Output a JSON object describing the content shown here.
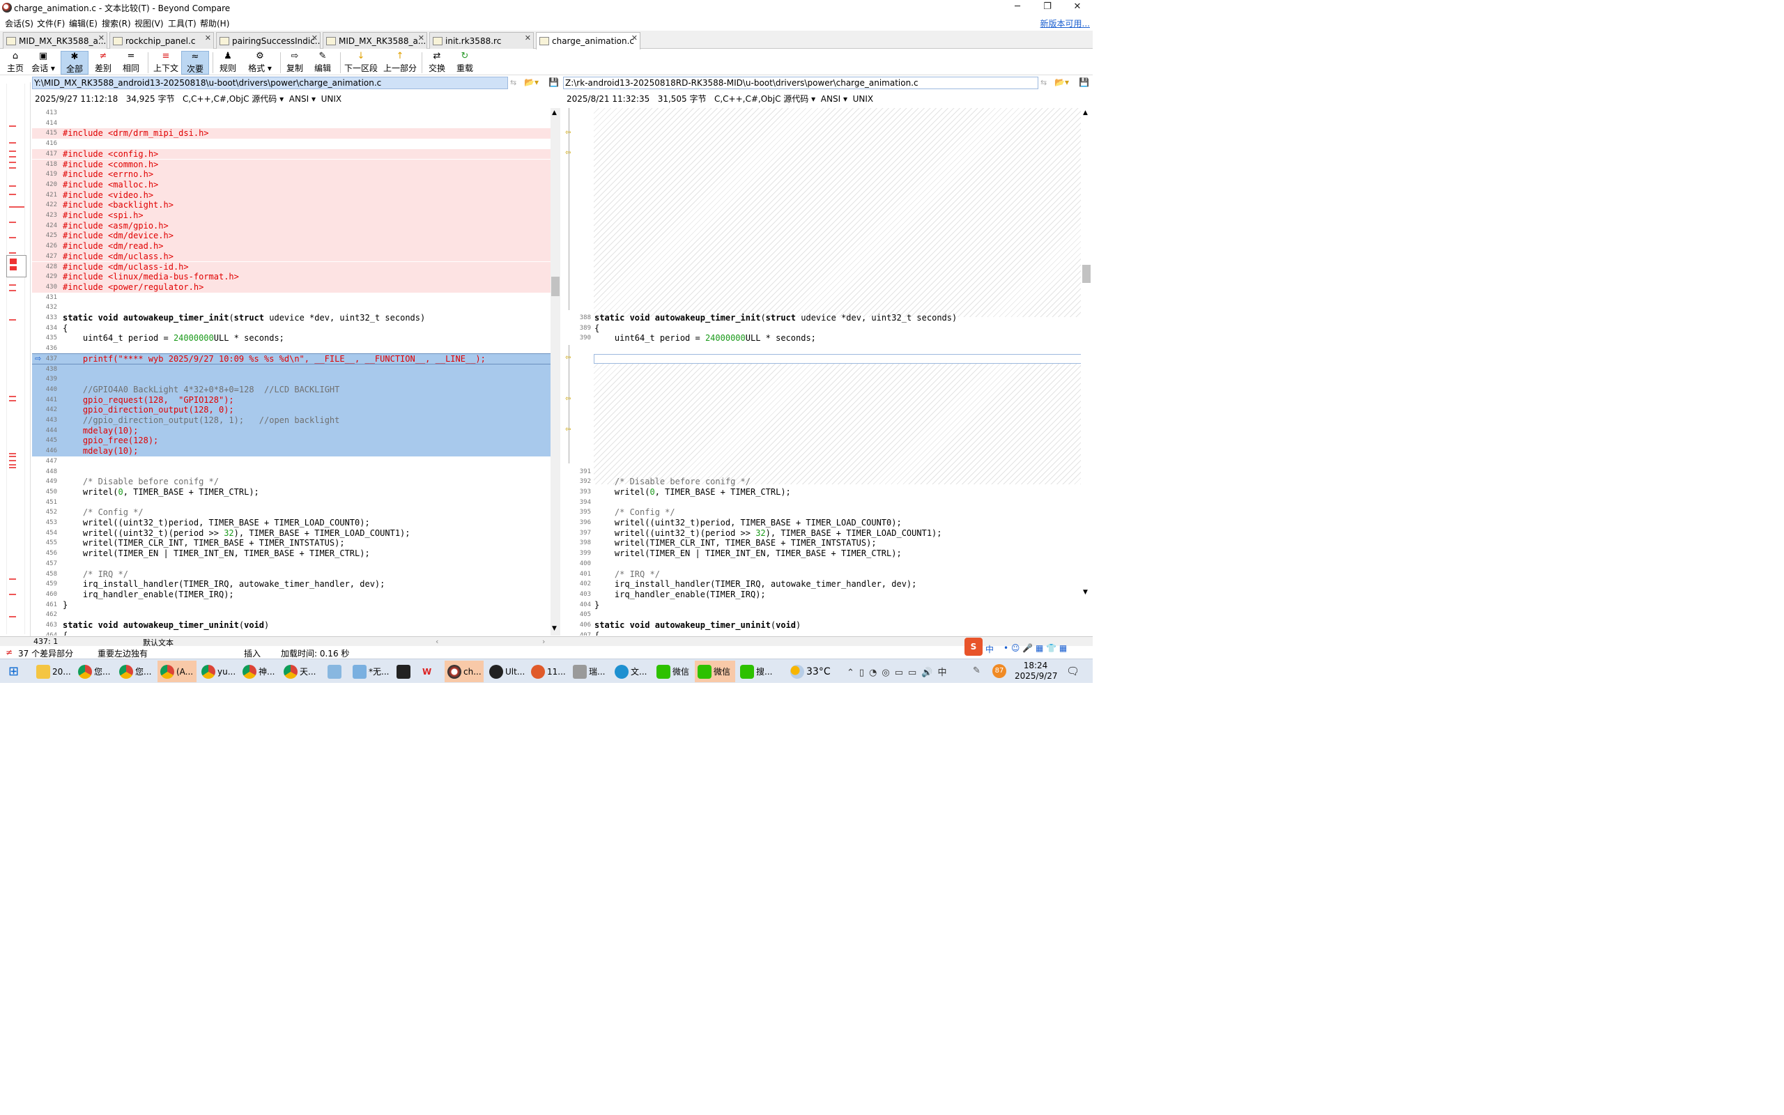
{
  "window": {
    "title": "charge_animation.c - 文本比较(T) - Beyond Compare",
    "min": "─",
    "max": "❐",
    "close": "✕"
  },
  "menu": {
    "items": [
      "会话(S)",
      "文件(F)",
      "编辑(E)",
      "搜索(R)",
      "视图(V)",
      "工具(T)",
      "帮助(H)"
    ],
    "notice": "新版本可用..."
  },
  "tabs": [
    "MID_MX_RK3588_a...",
    "rockchip_panel.c",
    "pairingSuccessIndic...",
    "MID_MX_RK3588_a...",
    "init.rk3588.rc",
    "charge_animation.c"
  ],
  "toolbar": {
    "home": "主页",
    "session": "会话",
    "all": "全部",
    "diff": "差别",
    "same": "相同",
    "context": "上下文",
    "minor": "次要",
    "rules": "规则",
    "format": "格式",
    "copy": "复制",
    "edit": "编辑",
    "next": "下一区段",
    "prev": "上一部分",
    "swap": "交换",
    "reload": "重载"
  },
  "left": {
    "path": "Y:\\MID_MX_RK3588_android13-20250818\\u-boot\\drivers\\power\\charge_animation.c",
    "date": "2025/9/27 11:12:18",
    "size": "34,925 字节",
    "lang": "C,C++,C#,ObjC 源代码",
    "enc": "ANSI",
    "eol": "UNIX"
  },
  "right": {
    "path": "Z:\\rk-android13-20250818RD-RK3588-MID\\u-boot\\drivers\\power\\charge_animation.c",
    "date": "2025/8/21 11:32:35",
    "size": "31,505 字节",
    "lang": "C,C++,C#,ObjC 源代码",
    "enc": "ANSI",
    "eol": "UNIX"
  },
  "status": {
    "pos": "437: 1",
    "mode": "默认文本",
    "diffs": "37 个差异部分",
    "importance": "重要左边独有",
    "insert": "插入",
    "load": "加载时间: 0.16 秒"
  },
  "taskbar": {
    "items": [
      "20...",
      "您...",
      "您...",
      "(A...",
      "yu...",
      "神...",
      "天...",
      "*无...",
      "ch...",
      "Ult...",
      "11...",
      "瑞...",
      "文...",
      "微信",
      "微信",
      "搜..."
    ],
    "temp": "33°C",
    "time": "18:24",
    "date": "2025/9/27",
    "ime": "中",
    "badge": "87"
  },
  "colors": {
    "deleted": "#e00000",
    "changedBg": "#a8c9ec",
    "removedBg": "#fde3e3",
    "accent": "#1a5fd0"
  }
}
